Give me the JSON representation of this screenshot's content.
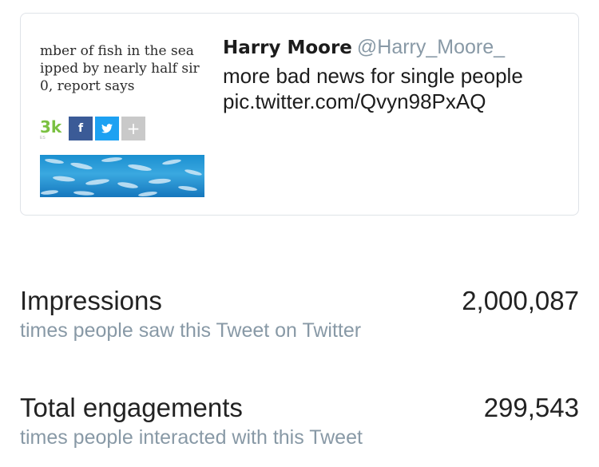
{
  "tweet": {
    "display_name": "Harry Moore",
    "handle": "@Harry_Moore_",
    "text": "more bad news for single people",
    "link": "pic.twitter.com/Qvyn98PxAQ",
    "attachment": {
      "headline_lines": [
        "mber of fish in the sea",
        "ipped by nearly half sir",
        "0, report says"
      ],
      "share_count": "3k",
      "share_count_caption": "ES",
      "share_buttons": {
        "facebook": "f",
        "twitter": "t",
        "more": "+"
      }
    }
  },
  "metrics": {
    "impressions": {
      "label": "Impressions",
      "value": "2,000,087",
      "description": "times people saw this Tweet on Twitter"
    },
    "engagements": {
      "label": "Total engagements",
      "value": "299,543",
      "description": "times people interacted with this Tweet"
    }
  },
  "colors": {
    "handle": "#8899a6",
    "description": "#8899a6",
    "share_count": "#7bc142",
    "facebook": "#3b5b97",
    "twitter": "#1da1f2",
    "more": "#c9c9c9",
    "card_border": "#dfe3e8"
  }
}
